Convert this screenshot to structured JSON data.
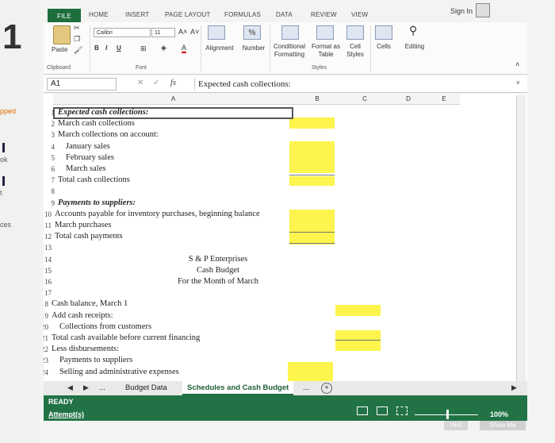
{
  "left_panel": {
    "step_number": "1",
    "side_labels": [
      "pped",
      "ok",
      "t",
      "ces"
    ]
  },
  "ribbon": {
    "tabs": [
      "FILE",
      "HOME",
      "INSERT",
      "PAGE LAYOUT",
      "FORMULAS",
      "DATA",
      "REVIEW",
      "VIEW"
    ],
    "sign_in": "Sign In",
    "clipboard": {
      "paste": "Paste",
      "group": "Clipboard"
    },
    "font": {
      "name": "Calibri",
      "size": "11",
      "bold": "B",
      "italic": "I",
      "underline": "U",
      "group": "Font"
    },
    "alignment": "Alignment",
    "number": "Number",
    "number_symbol": "%",
    "styles": {
      "conditional": [
        "Conditional",
        "Formatting"
      ],
      "format_table": [
        "Format as",
        "Table"
      ],
      "cell_styles": [
        "Cell",
        "Styles"
      ],
      "group": "Styles"
    },
    "cells": "Cells",
    "editing": "Editing"
  },
  "formula_bar": {
    "name_box": "A1",
    "fx": "fx",
    "content": "Expected cash collections:"
  },
  "grid": {
    "columns": [
      "A",
      "B",
      "C",
      "D",
      "E"
    ],
    "rows": [
      {
        "n": "1",
        "text": "Expected cash collections:",
        "style": "ital"
      },
      {
        "n": "2",
        "text": "March cash collections"
      },
      {
        "n": "3",
        "text": "March collections on account:"
      },
      {
        "n": "4",
        "text": "January sales",
        "indent": 1
      },
      {
        "n": "5",
        "text": "February sales",
        "indent": 1
      },
      {
        "n": "6",
        "text": "March sales",
        "indent": 1
      },
      {
        "n": "7",
        "text": "Total cash collections"
      },
      {
        "n": "8",
        "text": ""
      },
      {
        "n": "9",
        "text": "Payments to suppliers:",
        "style": "ital"
      },
      {
        "n": "10",
        "text": "Accounts payable for inventory purchases, beginning balance"
      },
      {
        "n": "11",
        "text": "March purchases"
      },
      {
        "n": "12",
        "text": "Total cash payments"
      },
      {
        "n": "13",
        "text": ""
      },
      {
        "n": "14",
        "text": "S & P Enterprises",
        "center": true
      },
      {
        "n": "15",
        "text": "Cash Budget",
        "center": true
      },
      {
        "n": "16",
        "text": "For the Month of March",
        "center": true
      },
      {
        "n": "17",
        "text": ""
      },
      {
        "n": "18",
        "text": "Cash balance, March 1"
      },
      {
        "n": "19",
        "text": "Add cash receipts:"
      },
      {
        "n": "20",
        "text": "Collections from customers",
        "indent": 1
      },
      {
        "n": "21",
        "text": "Total cash available before current financing"
      },
      {
        "n": "22",
        "text": "Less disbursements:"
      },
      {
        "n": "23",
        "text": "Payments to suppliers",
        "indent": 1
      },
      {
        "n": "24",
        "text": "Selling and administrative expenses",
        "indent": 1
      }
    ]
  },
  "sheet_tabs": {
    "ellipsis": "...",
    "tabs": [
      "Budget Data",
      "Schedules and Cash Budget"
    ],
    "add": "+"
  },
  "status_bar": {
    "ready": "READY",
    "attempts": "Attempt(s)",
    "zoom": "100%",
    "hint": "Hint",
    "show_me": "Show Me"
  },
  "colors": {
    "excel_green": "#217346",
    "highlight_yellow": "#fdf44d"
  }
}
